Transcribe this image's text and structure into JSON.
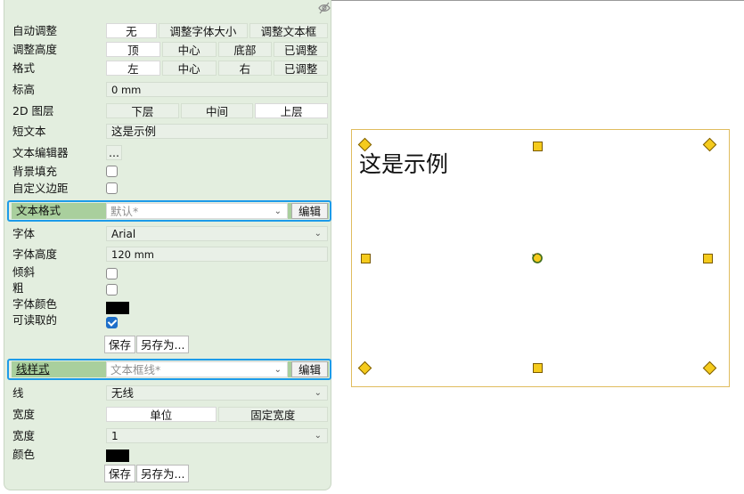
{
  "panel": {
    "auto_adjust": {
      "label": "自动调整",
      "options": [
        "无",
        "调整字体大小",
        "调整文本框"
      ]
    },
    "adjust_height": {
      "label": "调整高度",
      "options": [
        "顶",
        "中心",
        "底部",
        "已调整"
      ]
    },
    "format": {
      "label": "格式",
      "options": [
        "左",
        "中心",
        "右",
        "已调整"
      ]
    },
    "elevation": {
      "label": "标高",
      "value": "0 mm"
    },
    "layer_2d": {
      "label": "2D 图层",
      "options": [
        "下层",
        "中间",
        "上层"
      ]
    },
    "short_text": {
      "label": "短文本",
      "value": "这是示例"
    },
    "text_editor": {
      "label": "文本编辑器",
      "value": "..."
    },
    "background_fill": {
      "label": "背景填充"
    },
    "custom_margin": {
      "label": "自定义边距"
    },
    "text_format": {
      "label": "文本格式",
      "value": "默认*",
      "edit_label": "编辑"
    },
    "font": {
      "label": "字体",
      "value": "Arial"
    },
    "font_height": {
      "label": "字体高度",
      "value": "120 mm"
    },
    "italic": {
      "label": "倾斜"
    },
    "bold": {
      "label": "粗"
    },
    "font_color": {
      "label": "字体颜色",
      "color": "#000000"
    },
    "readable": {
      "label": "可读取的",
      "checked": true
    },
    "save_label": "保存",
    "save_as_label": "另存为...",
    "line_style": {
      "label": "线样式",
      "value": "文本框线*",
      "edit_label": "编辑"
    },
    "line": {
      "label": "线",
      "value": "无线"
    },
    "width_mode": {
      "label": "宽度",
      "options": [
        "单位",
        "固定宽度"
      ]
    },
    "width": {
      "label": "宽度",
      "value": "1"
    },
    "color": {
      "label": "颜色",
      "color": "#000000"
    }
  },
  "canvas": {
    "text": "这是示例"
  },
  "colors": {
    "panel_bg": "#e3eedf",
    "highlight": "#1d9be9",
    "handle": "#f5cb1d",
    "frame": "#e0bc5e"
  }
}
